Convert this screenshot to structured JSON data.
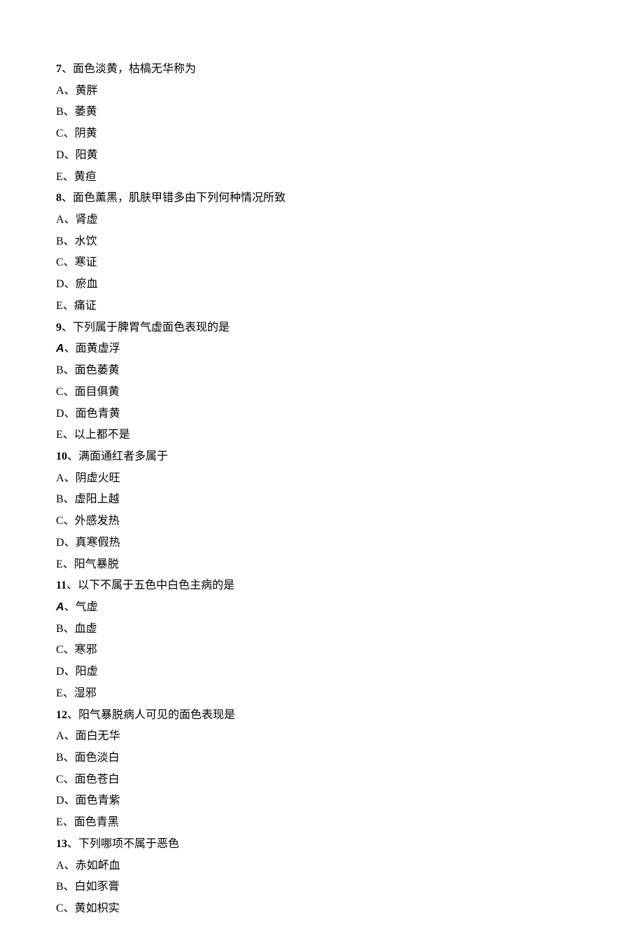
{
  "questions": [
    {
      "num": "7",
      "stem": "、面色淡黄，枯槁无华称为",
      "options": [
        {
          "letter": "A",
          "bold": false,
          "text": "、黄胖"
        },
        {
          "letter": "B",
          "bold": false,
          "text": "、萎黄"
        },
        {
          "letter": "C",
          "bold": false,
          "text": "、阴黄"
        },
        {
          "letter": "D",
          "bold": false,
          "text": "、阳黄"
        },
        {
          "letter": "E",
          "bold": false,
          "text": "、黄疸"
        }
      ]
    },
    {
      "num": "8",
      "stem": "、面色薰黑，肌肤甲错多由下列何种情况所致",
      "options": [
        {
          "letter": "A",
          "bold": false,
          "text": "、肾虚"
        },
        {
          "letter": "B",
          "bold": false,
          "text": "、水饮"
        },
        {
          "letter": "C",
          "bold": false,
          "text": "、寒证"
        },
        {
          "letter": "D",
          "bold": false,
          "text": "、瘀血"
        },
        {
          "letter": "E",
          "bold": false,
          "text": "、痛证"
        }
      ]
    },
    {
      "num": "9",
      "stem": "、下列属于脾胃气虚面色表现的是",
      "options": [
        {
          "letter": "A",
          "bold": true,
          "text": "、面黄虚浮"
        },
        {
          "letter": "B",
          "bold": false,
          "text": "、面色萎黄"
        },
        {
          "letter": "C",
          "bold": false,
          "text": "、面目俱黄"
        },
        {
          "letter": "D",
          "bold": false,
          "text": "、面色青黄"
        },
        {
          "letter": "E",
          "bold": false,
          "text": "、以上都不是"
        }
      ]
    },
    {
      "num": "10",
      "stem": "、满面通红者多属于",
      "options": [
        {
          "letter": "A",
          "bold": false,
          "text": "、阴虚火旺"
        },
        {
          "letter": "B",
          "bold": false,
          "text": "、虚阳上越"
        },
        {
          "letter": "C",
          "bold": false,
          "text": "、外感发热"
        },
        {
          "letter": "D",
          "bold": false,
          "text": "、真寒假热"
        },
        {
          "letter": "E",
          "bold": false,
          "text": "、阳气暴脱"
        }
      ]
    },
    {
      "num": "11",
      "stem": "、以下不属于五色中白色主病的是",
      "options": [
        {
          "letter": "A",
          "bold": true,
          "text": "、气虚"
        },
        {
          "letter": "B",
          "bold": false,
          "text": "、血虚"
        },
        {
          "letter": "C",
          "bold": false,
          "text": "、寒邪"
        },
        {
          "letter": "D",
          "bold": false,
          "text": "、阳虚"
        },
        {
          "letter": "E",
          "bold": false,
          "text": "、湿邪"
        }
      ]
    },
    {
      "num": "12",
      "stem": "、阳气暴脱病人可见的面色表现是",
      "options": [
        {
          "letter": "A",
          "bold": false,
          "text": "、面白无华"
        },
        {
          "letter": "B",
          "bold": false,
          "text": "、面色淡白"
        },
        {
          "letter": "C",
          "bold": false,
          "text": "、面色苍白"
        },
        {
          "letter": "D",
          "bold": false,
          "text": "、面色青紫"
        },
        {
          "letter": "E",
          "bold": false,
          "text": "、面色青黑"
        }
      ]
    },
    {
      "num": "13",
      "stem": "、下列哪项不属于恶色",
      "options": [
        {
          "letter": "A",
          "bold": false,
          "text": "、赤如衃血"
        },
        {
          "letter": "B",
          "bold": false,
          "text": "、白如豕膏"
        },
        {
          "letter": "C",
          "bold": false,
          "text": "、黄如枳实"
        }
      ]
    }
  ]
}
